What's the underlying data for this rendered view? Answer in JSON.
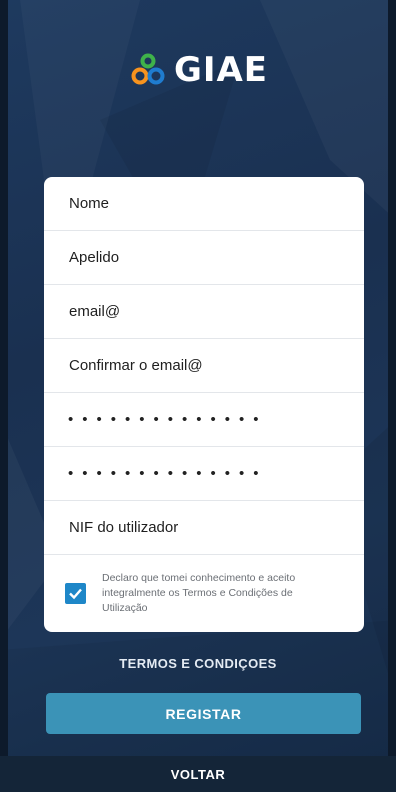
{
  "brand": {
    "name": "GIAE",
    "logo_icon": "giae-rings-icon",
    "logo_colors": [
      "#3fb24a",
      "#f7931e",
      "#1f7ccf"
    ]
  },
  "form": {
    "fields": [
      {
        "key": "nome",
        "placeholder": "Nome",
        "value": ""
      },
      {
        "key": "apelido",
        "placeholder": "Apelido",
        "value": ""
      },
      {
        "key": "email",
        "placeholder": "email@",
        "value": ""
      },
      {
        "key": "confirm_email",
        "placeholder": "Confirmar o email@",
        "value": ""
      },
      {
        "key": "password",
        "display": "••••••••••••••"
      },
      {
        "key": "confirm_password",
        "display": "••••••••••••••"
      },
      {
        "key": "nif",
        "placeholder": "NIF do utilizador",
        "value": ""
      }
    ],
    "consent": {
      "checked": true,
      "text": "Declaro que tomei conhecimento e aceito integralmente os Termos e Condições de Utilização"
    }
  },
  "actions": {
    "terms_label": "TERMOS E CONDIÇOES",
    "register_label": "REGISTAR",
    "back_label": "VOLTAR"
  },
  "colors": {
    "background": "#1b3455",
    "accent_button": "#3b93b7",
    "checkbox": "#1e87c8"
  }
}
